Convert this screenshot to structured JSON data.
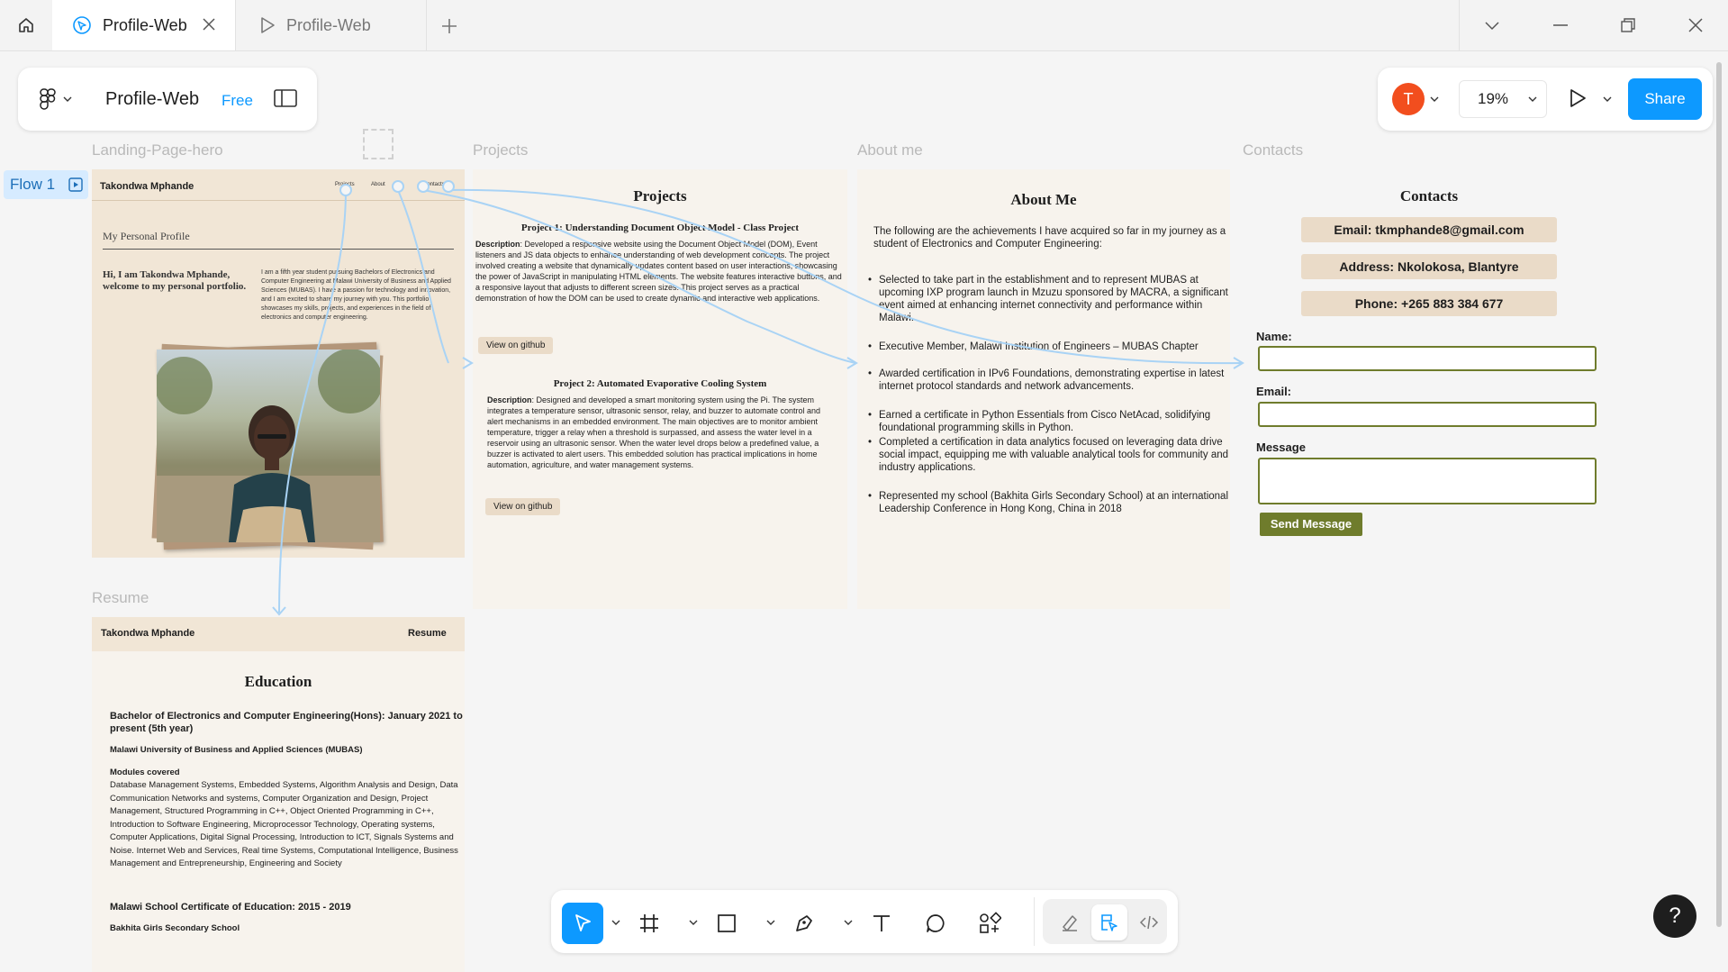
{
  "tabs": [
    {
      "label": "Profile-Web"
    },
    {
      "label": "Profile-Web"
    }
  ],
  "file": {
    "name": "Profile-Web",
    "plan": "Free"
  },
  "flow": {
    "label": "Flow 1"
  },
  "header_right": {
    "avatar_letter": "T",
    "zoom": "19%",
    "share_label": "Share"
  },
  "frames": {
    "hero": "Landing-Page-hero",
    "projects": "Projects",
    "about": "About me",
    "contacts": "Contacts",
    "resume": "Resume"
  },
  "hero": {
    "name": "Takondwa Mphande",
    "nav": [
      "Projects",
      "About",
      "Contacts"
    ],
    "subtitle": "My Personal Profile",
    "greeting": "Hi, I am Takondwa Mphande, welcome to my personal portfolio.",
    "bio": "I am a fifth year student pursuing Bachelors of Electronics and Computer Engineering at Malawi University of Business and Applied Sciences (MUBAS). I have a passion for technology and innovation, and I am excited to share my journey with you. This portfolio showcases my skills, projects, and experiences in the field of electronics and computer engineering."
  },
  "projects": {
    "title": "Projects",
    "p1_title": "Project 1: Understanding Document Object Model - Class Project",
    "p1_label": "Description",
    "p1_desc": ": Developed a responsive website using the Document Object Model (DOM), Event listeners and JS data objects to enhance understanding of web development concepts. The project involved creating a website that dynamically updates content based on user interactions, showcasing the power of JavaScript in manipulating HTML elements. The website features interactive buttons, and a responsive layout that adjusts to different screen sizes. This project serves as a practical demonstration of how the DOM can be used to create dynamic and interactive web applications.",
    "p1_button": "View on github",
    "p2_title": "Project 2: Automated Evaporative Cooling System",
    "p2_label": "Description",
    "p2_desc": ": Designed and developed a smart monitoring system using the Pi. The system integrates a temperature sensor, ultrasonic sensor, relay, and buzzer to automate control and alert mechanisms in an embedded environment. The main objectives are to monitor ambient temperature, trigger a relay when a threshold is surpassed, and assess the water level in a reservoir using an ultrasonic sensor. When the water level drops below a predefined value, a buzzer is activated to alert users. This embedded solution has practical implications in home automation, agriculture, and water management systems.",
    "p2_button": "View on github"
  },
  "about": {
    "title": "About Me",
    "intro": "The following are the achievements I have acquired so far in my journey as a student of Electronics and Computer Engineering:",
    "items": [
      "Selected to take part in the establishment and to represent MUBAS at upcoming IXP program launch in Mzuzu sponsored by MACRA, a significant event aimed at enhancing internet connectivity and performance within Malawi.",
      "Executive Member, Malawi Institution of Engineers – MUBAS Chapter",
      "Awarded certification in IPv6 Foundations, demonstrating expertise in latest internet protocol standards and network advancements.",
      "Earned a certificate in Python Essentials from Cisco NetAcad, solidifying foundational programming skills in Python.",
      "Completed a certification in data analytics focused on leveraging data drive social impact, equipping me with valuable analytical tools for community and industry applications.",
      "Represented my school (Bakhita Girls Secondary School) at an international Leadership Conference in Hong Kong, China in 2018"
    ]
  },
  "contacts": {
    "title": "Contacts",
    "email": "Email: tkmphande8@gmail.com",
    "address": "Address: Nkolokosa, Blantyre",
    "phone": "Phone: +265 883 384 677",
    "name_label": "Name:",
    "email_label": "Email:",
    "message_label": "Message",
    "send_label": "Send Message"
  },
  "resume": {
    "name": "Takondwa Mphande",
    "nav": "Resume",
    "title": "Education",
    "degree": "Bachelor of Electronics and Computer Engineering(Hons): January 2021 to present (5th year)",
    "university": "Malawi University of Business and Applied Sciences (MUBAS)",
    "modules_label": "Modules covered",
    "modules": "Database Management Systems, Embedded Systems, Algorithm Analysis and Design, Data Communication Networks and systems, Computer Organization and Design, Project Management, Structured Programming in C++, Object Oriented Programming in C++, Introduction to Software Engineering, Microprocessor Technology, Operating systems, Computer Applications, Digital Signal Processing, Introduction to ICT, Signals Systems and Noise. Internet Web and Services, Real time Systems, Computational Intelligence, Business Management and Entrepreneurship, Engineering and Society",
    "msce": "Malawi School Certificate of Education: 2015 - 2019",
    "school": "Bakhita Girls Secondary School"
  },
  "toolbar_icons": [
    "move-icon",
    "frame-icon",
    "rectangle-icon",
    "pen-icon",
    "text-icon",
    "comment-icon",
    "components-icon",
    "draw-icon",
    "prototype-icon",
    "dev-mode-icon"
  ],
  "colors": {
    "accent": "#0d99ff",
    "frame_bg": "#f1e6d6",
    "olive": "#6f7c2c",
    "avatar": "#f24e1e",
    "connector": "#a9d3f5"
  }
}
